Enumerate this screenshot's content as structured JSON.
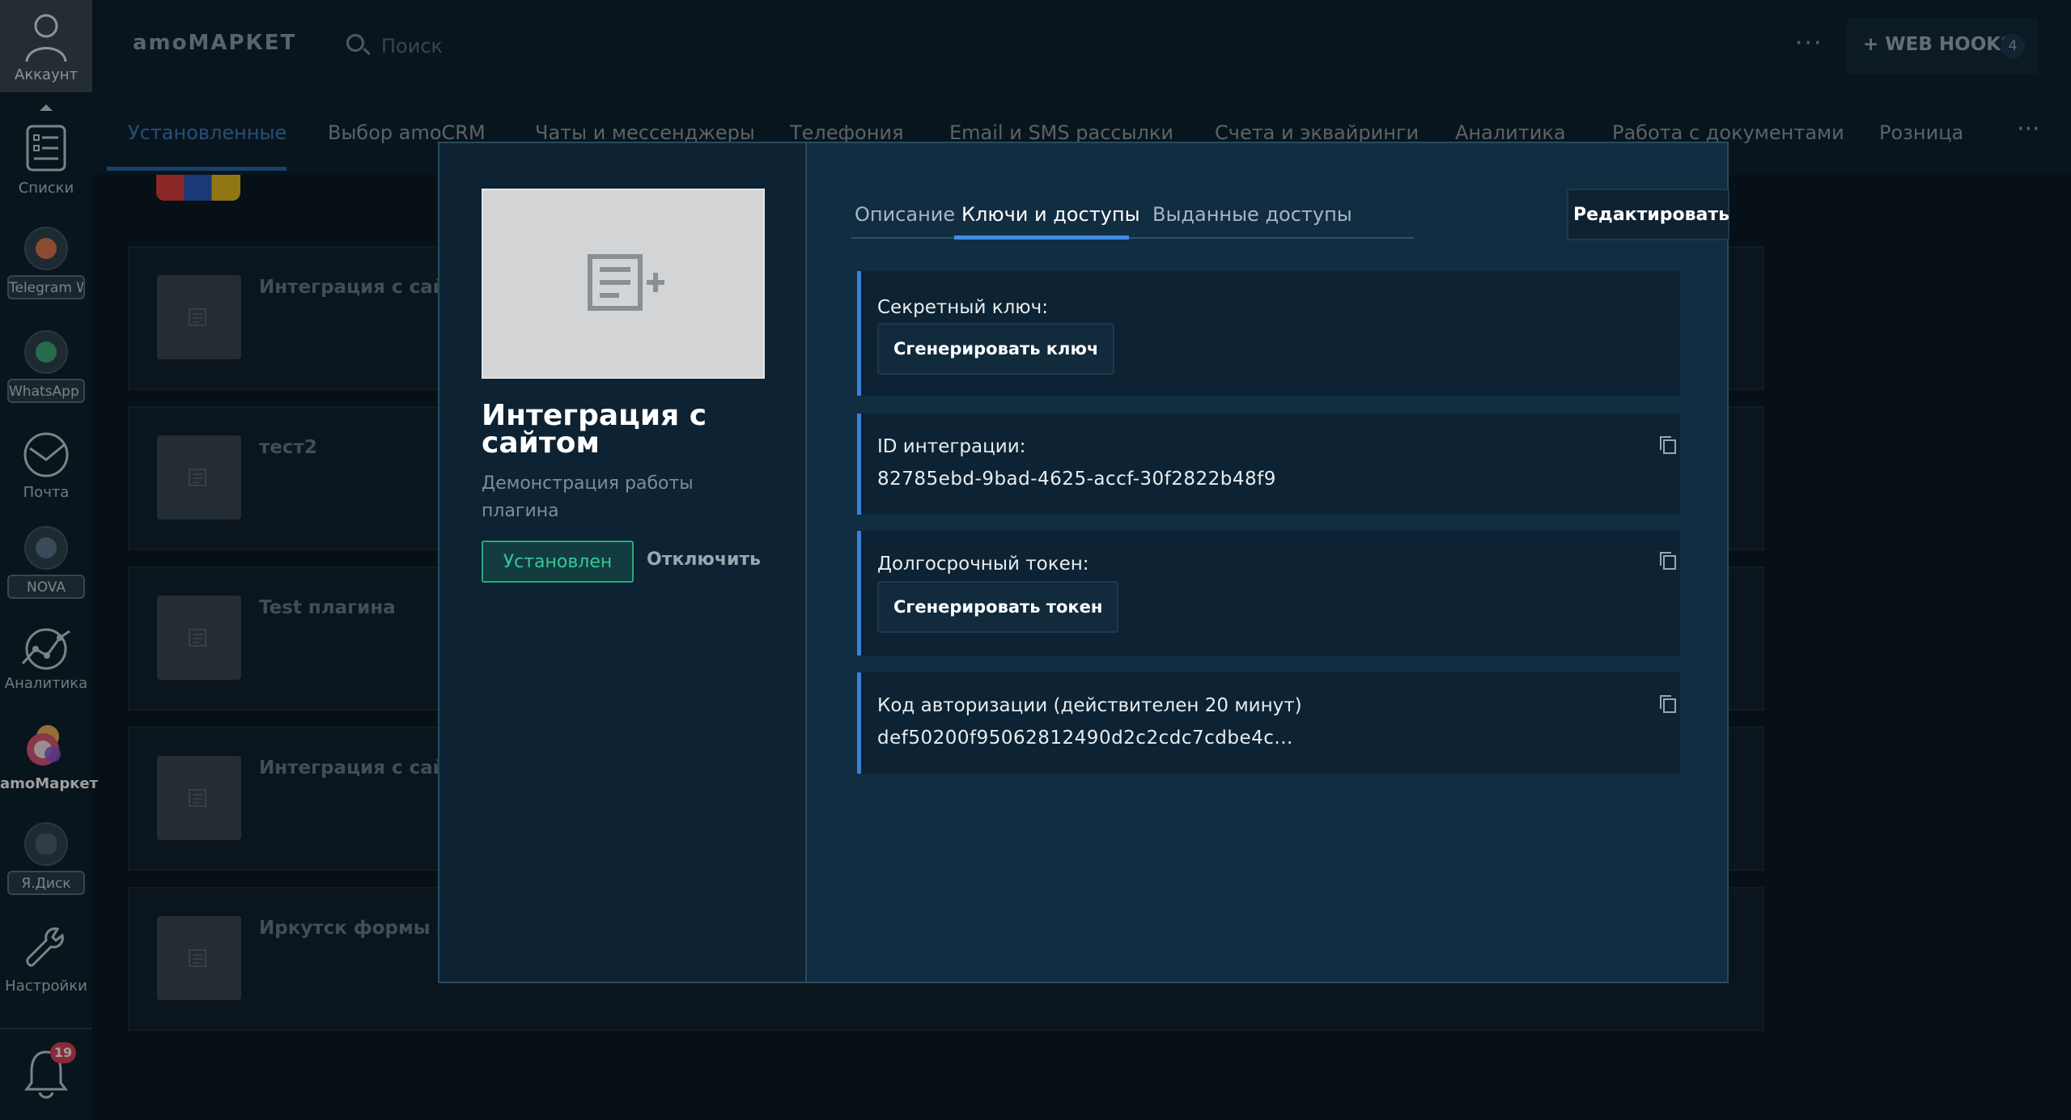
{
  "sidebar": {
    "account_label": "Аккаунт",
    "lists_label": "Списки",
    "telegram_label": "Telegram W",
    "whatsapp_label": "WhatsApp W",
    "mail_label": "Почта",
    "nova_label": "NOVA",
    "analytics_label": "Аналитика",
    "market_label": "amoМаркет",
    "yadisk_label": "Я.Диск",
    "settings_label": "Настройки",
    "notifications_count": "19"
  },
  "topbar": {
    "brand": "amoМАРКЕТ",
    "search_placeholder": "Поиск",
    "more": "···",
    "webhooks_label": "+ WEB HOOKS",
    "webhooks_count": "4"
  },
  "tabs": [
    {
      "label": "Установленные",
      "active": true
    },
    {
      "label": "Выбор amoCRM"
    },
    {
      "label": "Чаты и мессенджеры"
    },
    {
      "label": "Телефония"
    },
    {
      "label": "Email и SMS рассылки"
    },
    {
      "label": "Счета и эквайринги"
    },
    {
      "label": "Аналитика"
    },
    {
      "label": "Работа с документами"
    },
    {
      "label": "Розница"
    }
  ],
  "tabs_more": "···",
  "list": [
    {
      "title": "Интеграция с сайто"
    },
    {
      "title": "тест2"
    },
    {
      "title": "Test плагина"
    },
    {
      "title": "Интеграция с сайта"
    },
    {
      "title": "Иркутск формы с са"
    }
  ],
  "modal": {
    "title": "Интеграция с сайтом",
    "description": "Демонстрация работы плагина",
    "installed_button": "Установлен",
    "disable_button": "Отключить",
    "tabs": {
      "description": "Описание",
      "keys": "Ключи и доступы",
      "granted": "Выданные доступы"
    },
    "edit_button": "Редактировать",
    "secret_key": {
      "label": "Секретный ключ:",
      "button": "Сгенерировать ключ"
    },
    "integration_id": {
      "label": "ID интеграции:",
      "value": "82785ebd-9bad-4625-accf-30f2822b48f9"
    },
    "long_token": {
      "label": "Долгосрочный токен:",
      "button": "Сгенерировать токен"
    },
    "auth_code": {
      "label": "Код авторизации (действителен 20 минут)",
      "value": "def50200f95062812490d2c2cdc7cdbe4c..."
    }
  },
  "colors": {
    "accent_blue": "#3b82d6",
    "installed_green": "#36c79a",
    "badge_red": "#e0445a",
    "telegram": "#e07a52",
    "whatsapp": "#3fae78"
  }
}
